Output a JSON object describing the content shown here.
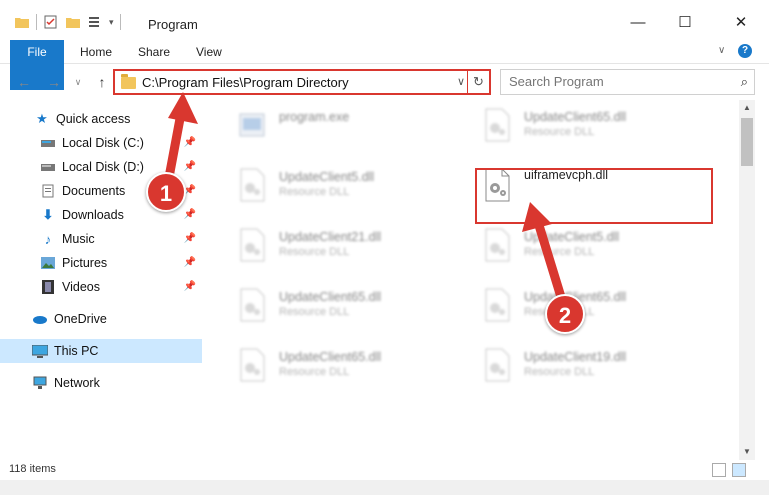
{
  "window": {
    "title": "Program",
    "minimize": "—",
    "maximize": "☐",
    "close": "✕"
  },
  "ribbon": {
    "tabs": [
      "File",
      "Home",
      "Share",
      "View"
    ]
  },
  "address": {
    "path": "C:\\Program Files\\Program Directory",
    "search_placeholder": "Search Program"
  },
  "sidebar": {
    "items": [
      {
        "label": "Quick access",
        "icon": "star-icon",
        "pinned": false
      },
      {
        "label": "Local Disk (C:)",
        "icon": "drive-icon",
        "pinned": true
      },
      {
        "label": "Local Disk (D:)",
        "icon": "drive-icon",
        "pinned": true
      },
      {
        "label": "Documents",
        "icon": "documents-icon",
        "pinned": true
      },
      {
        "label": "Downloads",
        "icon": "download-icon",
        "pinned": true
      },
      {
        "label": "Music",
        "icon": "music-icon",
        "pinned": true
      },
      {
        "label": "Pictures",
        "icon": "pictures-icon",
        "pinned": true
      },
      {
        "label": "Videos",
        "icon": "videos-icon",
        "pinned": true
      },
      {
        "label": "OneDrive",
        "icon": "cloud-icon",
        "pinned": false
      },
      {
        "label": "This PC",
        "icon": "computer-icon",
        "pinned": false,
        "selected": true
      },
      {
        "label": "Network",
        "icon": "network-icon",
        "pinned": false
      }
    ]
  },
  "files": [
    {
      "name": "program.exe",
      "type": ""
    },
    {
      "name": "UpdateClient65.dll",
      "type": "Resource DLL"
    },
    {
      "name": "UpdateClient5.dll",
      "type": "Resource DLL"
    },
    {
      "name": "uiframevcph.dll",
      "type": ""
    },
    {
      "name": "UpdateClient21.dll",
      "type": "Resource DLL"
    },
    {
      "name": "UpdateClient5.dll",
      "type": "Resource DLL"
    },
    {
      "name": "UpdateClient65.dll",
      "type": "Resource DLL"
    },
    {
      "name": "UpdateClient65.dll",
      "type": "Resource DLL"
    },
    {
      "name": "UpdateClient65.dll",
      "type": "Resource DLL"
    },
    {
      "name": "UpdateClient19.dll",
      "type": "Resource DLL"
    }
  ],
  "status": {
    "item_count": "118 items"
  },
  "callouts": [
    "1",
    "2"
  ],
  "colors": {
    "accent": "#1979ca",
    "highlight": "#d9372f",
    "selected_bg": "#cce8ff"
  }
}
